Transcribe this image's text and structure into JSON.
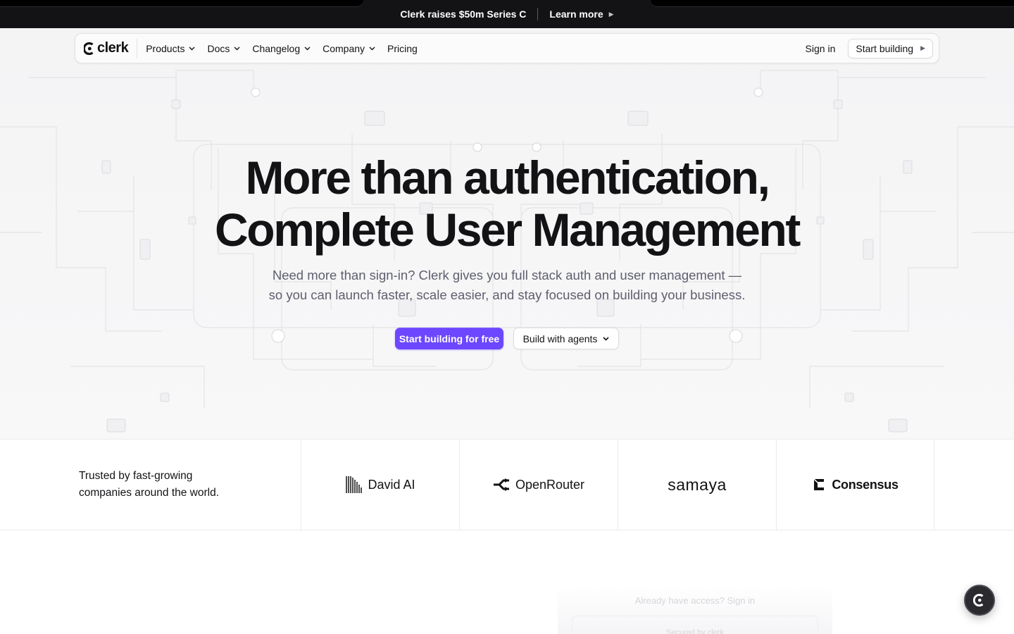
{
  "announcement": {
    "text": "Clerk raises $50m Series C",
    "link_label": "Learn more"
  },
  "nav": {
    "logo_text": "clerk",
    "items": [
      {
        "label": "Products",
        "has_dropdown": true
      },
      {
        "label": "Docs",
        "has_dropdown": true
      },
      {
        "label": "Changelog",
        "has_dropdown": true
      },
      {
        "label": "Company",
        "has_dropdown": true
      },
      {
        "label": "Pricing",
        "has_dropdown": false
      }
    ],
    "signin_label": "Sign in",
    "start_label": "Start building"
  },
  "hero": {
    "title_line1": "More than authentication,",
    "title_line2": "Complete User Management",
    "subtitle_line1": "Need more than sign-in? Clerk gives you full stack auth and user management —",
    "subtitle_line2": "so you can launch faster, scale easier, and stay focused on building your business.",
    "cta_primary": "Start building for free",
    "cta_secondary": "Build with agents"
  },
  "trusted": {
    "text_line1": "Trusted by fast-growing",
    "text_line2": "companies around the world.",
    "logos": [
      {
        "name": "David AI",
        "icon": "david-ai-bars-icon"
      },
      {
        "name": "OpenRouter",
        "icon": "openrouter-arrow-icon"
      },
      {
        "name": "samaya",
        "icon": "none"
      },
      {
        "name": "Consensus",
        "icon": "consensus-c-icon"
      }
    ]
  },
  "preview": {
    "text_top": "Already have access? Sign in",
    "text_bottom": "Secured by clerk"
  },
  "colors": {
    "accent": "#6c47ff",
    "text": "#131316",
    "muted": "#5e5f6e",
    "announcement_bg": "#131316"
  }
}
